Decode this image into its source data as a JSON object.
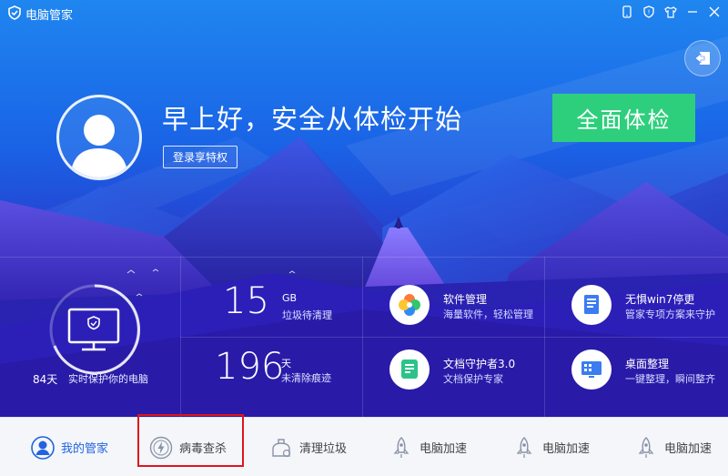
{
  "app": {
    "title": "电脑管家"
  },
  "colors": {
    "accent": "#2ecf7c",
    "active_nav": "#2163e0",
    "highlight": "#e0141c"
  },
  "titlebar_icons": [
    "phone-icon",
    "shield-icon",
    "tshirt-icon",
    "minimize-icon",
    "close-icon"
  ],
  "hero": {
    "greeting": "早上好，安全从体检开始",
    "login_label": "登录享特权",
    "scan_label": "全面体检"
  },
  "stats": {
    "protect_days": "84天",
    "protect_text": "实时保护你的电脑",
    "junk_value": "15",
    "junk_unit": "GB",
    "junk_text": "垃圾待清理",
    "trace_value": "196",
    "trace_unit": "天",
    "trace_text": "未清除痕迹"
  },
  "tools": [
    {
      "title": "软件管理",
      "subtitle": "海量软件，轻松管理",
      "icon": "software-icon"
    },
    {
      "title": "无惧win7停更",
      "subtitle": "管家专项方案来守护",
      "icon": "document-icon"
    },
    {
      "title": "文档守护者3.0",
      "subtitle": "文档保护专家",
      "icon": "file-guard-icon"
    },
    {
      "title": "桌面整理",
      "subtitle": "一键整理，瞬间整齐",
      "icon": "desktop-icon"
    }
  ],
  "nav": [
    {
      "label": "我的管家",
      "icon": "user-icon"
    },
    {
      "label": "病毒查杀",
      "icon": "virus-scan-icon"
    },
    {
      "label": "清理垃圾",
      "icon": "cleanup-icon"
    },
    {
      "label": "电脑加速",
      "icon": "rocket-icon"
    },
    {
      "label": "电脑加速",
      "icon": "rocket-icon"
    },
    {
      "label": "电脑加速",
      "icon": "rocket-icon"
    }
  ]
}
